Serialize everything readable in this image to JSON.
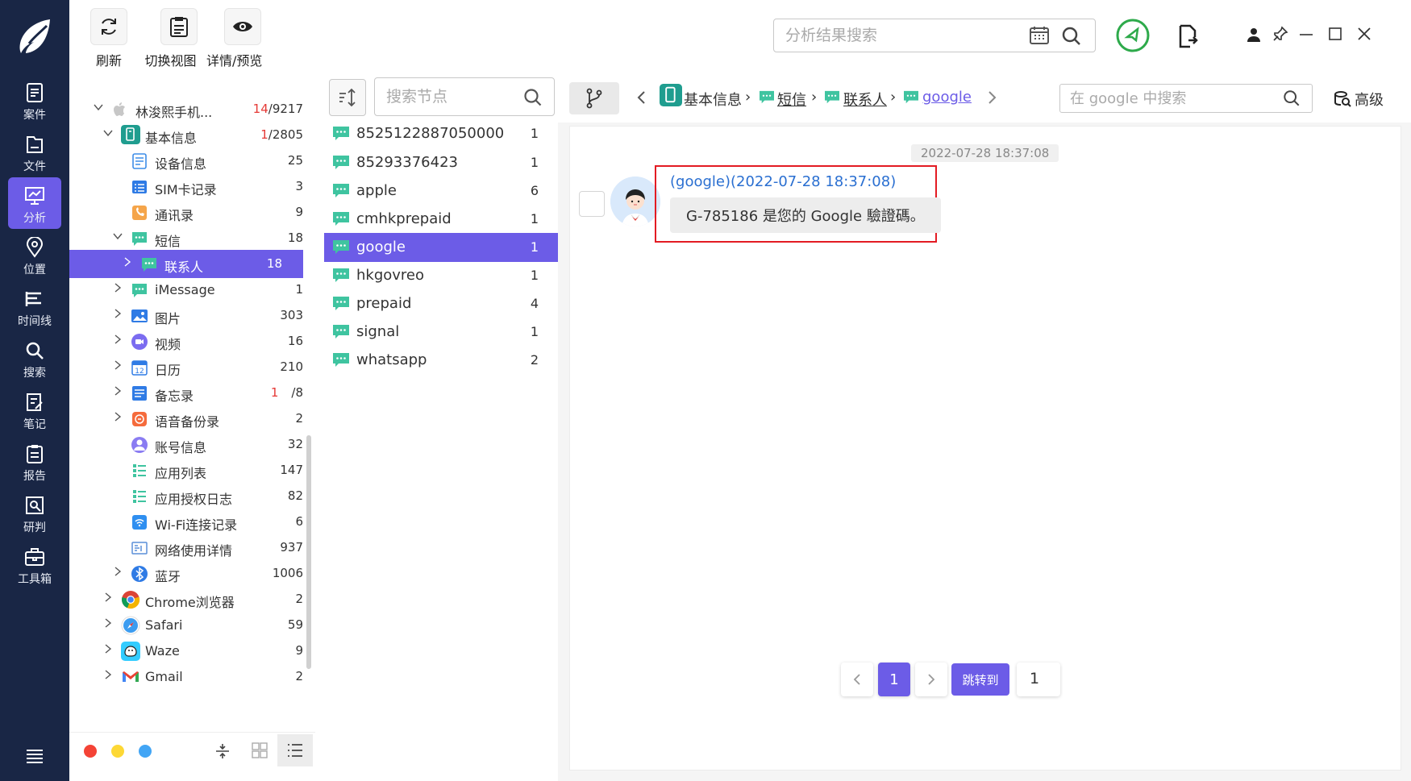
{
  "rail": {
    "items": [
      {
        "label": "案件",
        "icon": "case-icon"
      },
      {
        "label": "文件",
        "icon": "file-icon"
      },
      {
        "label": "分析",
        "icon": "analysis-icon"
      },
      {
        "label": "位置",
        "icon": "location-icon"
      },
      {
        "label": "时间线",
        "icon": "timeline-icon"
      },
      {
        "label": "搜索",
        "icon": "search-icon"
      },
      {
        "label": "笔记",
        "icon": "notes-icon"
      },
      {
        "label": "报告",
        "icon": "report-icon"
      },
      {
        "label": "研判",
        "icon": "judge-icon"
      },
      {
        "label": "工具箱",
        "icon": "toolbox-icon"
      }
    ],
    "active": "分析"
  },
  "toolbar": {
    "refresh": "刷新",
    "switch_view": "切换视图",
    "detail_preview": "详情/预览",
    "search_placeholder": "分析结果搜索"
  },
  "tree": {
    "root": {
      "label": "林浚熙手机...",
      "hit": "14",
      "total": "/9217"
    },
    "basic": {
      "label": "基本信息",
      "hit": "1",
      "total": "/2805"
    },
    "items": [
      {
        "label": "设备信息",
        "count": "25"
      },
      {
        "label": "SIM卡记录",
        "count": "3"
      },
      {
        "label": "通讯录",
        "count": "9"
      },
      {
        "label": "短信",
        "count": "18"
      },
      {
        "label": "联系人",
        "count": "18"
      },
      {
        "label": "iMessage",
        "count": "1"
      },
      {
        "label": "图片",
        "count": "303"
      },
      {
        "label": "视频",
        "count": "16"
      },
      {
        "label": "日历",
        "count": "210"
      },
      {
        "label": "备忘录",
        "hit": "1",
        "count": "/8"
      },
      {
        "label": "语音备份录",
        "count": "2"
      },
      {
        "label": "账号信息",
        "count": "32"
      },
      {
        "label": "应用列表",
        "count": "147"
      },
      {
        "label": "应用授权日志",
        "count": "82"
      },
      {
        "label": "Wi-Fi连接记录",
        "count": "6"
      },
      {
        "label": "网络使用详情",
        "count": "937"
      },
      {
        "label": "蓝牙",
        "count": "1006"
      },
      {
        "label": "Chrome浏览器",
        "count": "2"
      },
      {
        "label": "Safari",
        "count": "59"
      },
      {
        "label": "Waze",
        "count": "9"
      },
      {
        "label": "Gmail",
        "count": "2"
      }
    ],
    "footer_colors": [
      "#f44336",
      "#fdd835",
      "#42a5f5"
    ]
  },
  "mid": {
    "search_placeholder": "搜索节点",
    "rows": [
      {
        "label": "8525122887050000",
        "count": "1"
      },
      {
        "label": "85293376423",
        "count": "1"
      },
      {
        "label": "apple",
        "count": "6"
      },
      {
        "label": "cmhkprepaid",
        "count": "1"
      },
      {
        "label": "google",
        "count": "1"
      },
      {
        "label": "hkgovreo",
        "count": "1"
      },
      {
        "label": "prepaid",
        "count": "4"
      },
      {
        "label": "signal",
        "count": "1"
      },
      {
        "label": "whatsapp",
        "count": "2"
      }
    ],
    "selected": "google"
  },
  "breadcrumb": {
    "items": [
      "基本信息",
      "短信",
      "联系人",
      "google"
    ],
    "search_placeholder": "在 google 中搜索",
    "advanced": "高级"
  },
  "message": {
    "date": "2022-07-28 18:37:08",
    "header": "(google)(2022-07-28 18:37:08)",
    "text": "G-785186 是您的 Google 驗證碼。"
  },
  "pager": {
    "current": "1",
    "jump_label": "跳转到",
    "jump_value": "1"
  },
  "colors": {
    "accent": "#6c5ce7",
    "rail": "#192645",
    "sms_icon": "#3fc4a0",
    "highlight_box": "#e31b23"
  }
}
